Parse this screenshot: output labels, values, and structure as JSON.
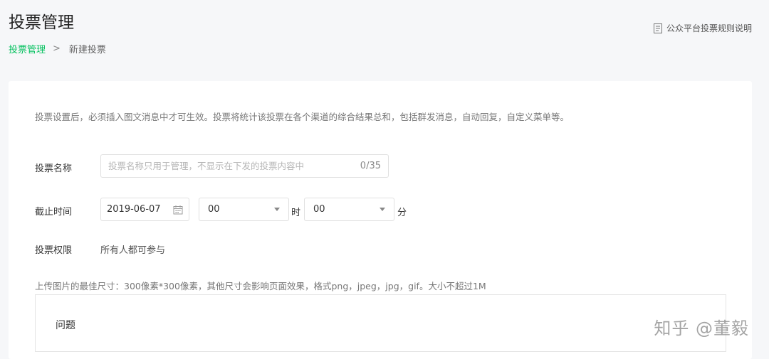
{
  "header": {
    "title": "投票管理",
    "rules_link": "公众平台投票规则说明",
    "rules_icon": "document-icon"
  },
  "breadcrumb": {
    "parent": "投票管理",
    "separator": ">",
    "current": "新建投票"
  },
  "form": {
    "notice": "投票设置后，必须插入图文消息中才可生效。投票将统计该投票在各个渠道的综合结果总和，包括群发消息，自动回复，自定义菜单等。",
    "name": {
      "label": "投票名称",
      "value": "",
      "placeholder": "投票名称只用于管理，不显示在下发的投票内容中",
      "counter": "0/35"
    },
    "deadline": {
      "label": "截止时间",
      "date": "2019-06-07",
      "hour": "00",
      "hour_unit": "时",
      "minute": "00",
      "minute_unit": "分"
    },
    "permission": {
      "label": "投票权限",
      "value": "所有人都可参与"
    },
    "upload_hint": "上传图片的最佳尺寸：300像素*300像素，其他尺寸会影响页面效果，格式png，jpeg，jpg，gif。大小不超过1M",
    "question_label": "问题"
  },
  "watermark": "知乎 @董毅",
  "colors": {
    "accent": "#07c160",
    "background": "#f6f7f9"
  }
}
